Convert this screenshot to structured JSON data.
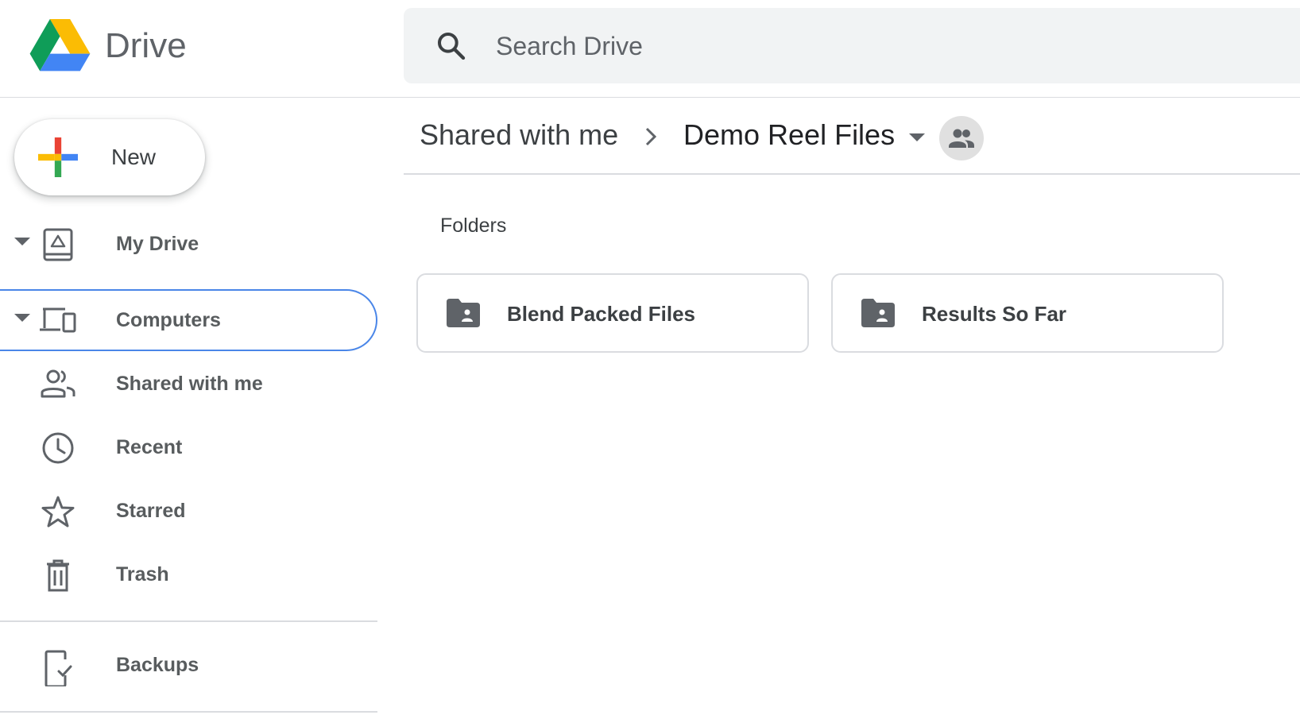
{
  "app": {
    "name": "Drive"
  },
  "search": {
    "placeholder": "Search Drive"
  },
  "sidebar": {
    "new_label": "New",
    "items": [
      {
        "label": "My Drive",
        "icon": "my-drive-icon"
      },
      {
        "label": "Computers",
        "icon": "computers-icon",
        "selected": true
      },
      {
        "label": "Shared with me",
        "icon": "people-icon"
      },
      {
        "label": "Recent",
        "icon": "clock-icon"
      },
      {
        "label": "Starred",
        "icon": "star-icon"
      },
      {
        "label": "Trash",
        "icon": "trash-icon"
      }
    ],
    "backups_label": "Backups"
  },
  "breadcrumb": {
    "parent": "Shared with me",
    "current": "Demo Reel Files"
  },
  "main": {
    "section_title": "Folders",
    "folders": [
      {
        "name": "Blend Packed Files",
        "icon": "shared-folder-icon"
      },
      {
        "name": "Results So Far",
        "icon": "shared-folder-icon"
      }
    ]
  },
  "colors": {
    "selected_outline": "#4a86e8",
    "icon_gray": "#5f6368",
    "search_bg": "#f1f3f4"
  }
}
